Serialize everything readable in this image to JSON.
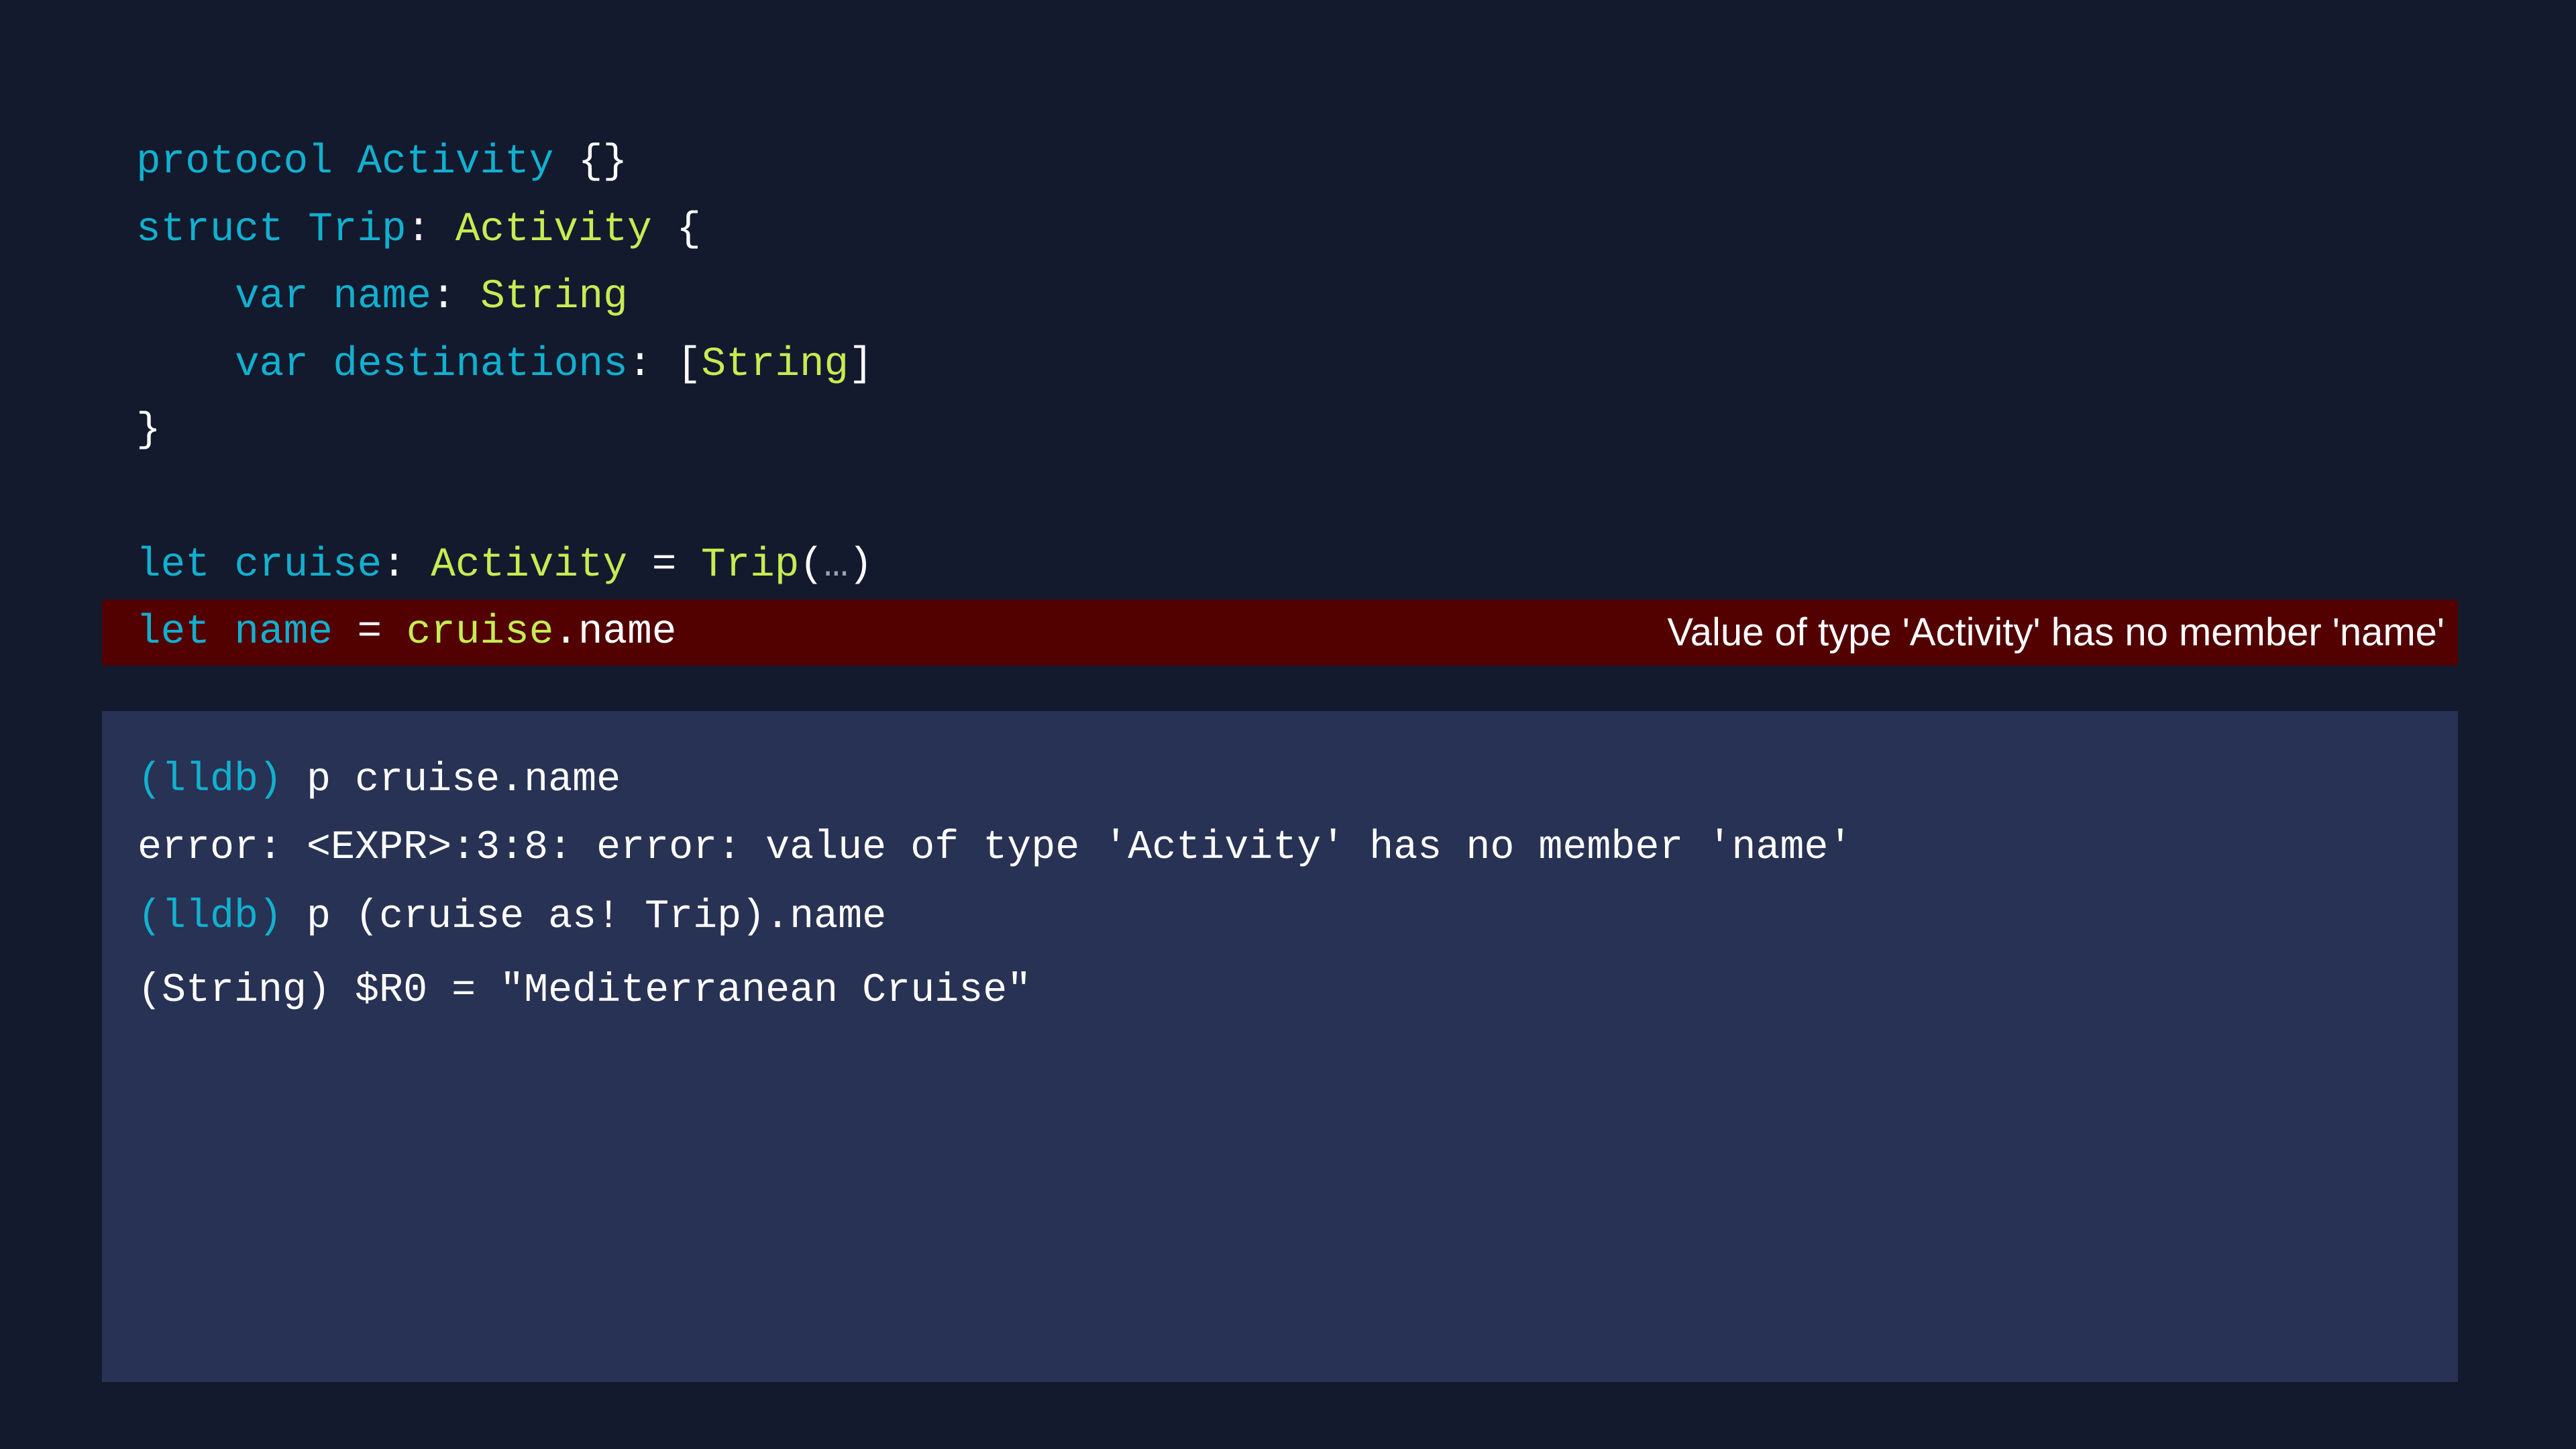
{
  "colors": {
    "background": "#131a2e",
    "keyword": "#12b0cf",
    "type": "#c6ec52",
    "error_bar": "#520000",
    "console_bg": "#283254"
  },
  "code": {
    "l1": {
      "a": "protocol Activity",
      "b": " {}"
    },
    "l2": {
      "a": "struct Trip",
      "b": ": ",
      "c": "Activity",
      "d": " {"
    },
    "l3": {
      "a": "var name",
      "b": ": ",
      "c": "String"
    },
    "l4": {
      "a": "var destinations",
      "b": ": [",
      "c": "String",
      "d": "]"
    },
    "l5": {
      "a": "}"
    },
    "l6": {
      "a": "let cruise",
      "b": ": ",
      "c": "Activity",
      "d": " = ",
      "e": "Trip",
      "f": "(",
      "g": "…",
      "h": ")"
    },
    "l7": {
      "a": "let name",
      "b": " = ",
      "c": "cruise",
      "d": ".name"
    }
  },
  "error_message": "Value of type 'Activity' has no member 'name'",
  "console": {
    "prompt": "(lldb)",
    "c1": " p cruise.name",
    "c2": "error: <EXPR>:3:8: error: value of type 'Activity' has no member 'name'",
    "c3": " p (cruise as! Trip).name",
    "c4": "(String) $R0 = \"Mediterranean Cruise\""
  }
}
